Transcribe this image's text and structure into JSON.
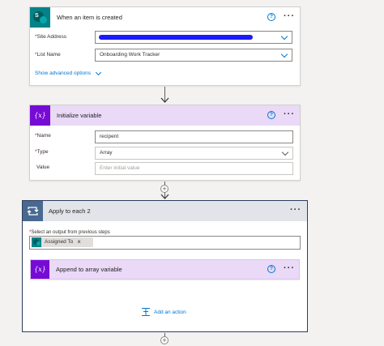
{
  "trigger": {
    "title": "When an item is created",
    "help": "?",
    "more": "···",
    "site_address_label": "Site Address",
    "list_name_label": "List Name",
    "list_name_value": "Onboarding Work Tracker",
    "advanced_label": "Show advanced options",
    "required_mark": "*"
  },
  "init_var": {
    "icon_text": "{x}",
    "title": "Initialize variable",
    "help": "?",
    "more": "···",
    "name_label": "Name",
    "name_value": "recipent",
    "type_label": "Type",
    "type_value": "Array",
    "value_label": "Value",
    "value_placeholder": "Enter initial value",
    "required_mark": "*"
  },
  "apply_each": {
    "title": "Apply to each 2",
    "more": "···",
    "select_label": "Select an output from previous steps",
    "required_mark": "*",
    "token_label": "Assigned To",
    "token_remove": "×"
  },
  "append": {
    "icon_text": "{x}",
    "title": "Append to array variable",
    "help": "?",
    "more": "···"
  },
  "add_action": {
    "label": "Add an action"
  },
  "connector_plus": "+",
  "colors": {
    "sharepoint": "#038387",
    "variable": "#770bd6",
    "variable_header": "#ead9f7",
    "apply_header": "#e1e5ea",
    "apply_border": "#2b3e5b",
    "link": "#0078d4"
  }
}
